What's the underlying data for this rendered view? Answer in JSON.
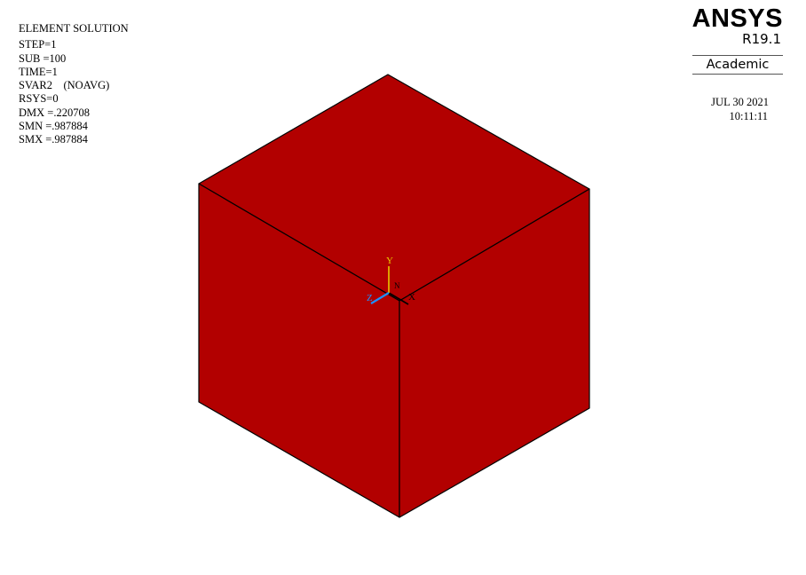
{
  "legend": {
    "title": "ELEMENT SOLUTION",
    "lines": [
      "STEP=1",
      "SUB =100",
      "TIME=1",
      "SVAR2    (NOAVG)",
      "RSYS=0",
      "DMX =.220708",
      "SMN =.987884",
      "SMX =.987884"
    ]
  },
  "brand": {
    "logo": "ANSYS",
    "version": "R19.1",
    "edition": "Academic"
  },
  "datetime": {
    "date": "JUL 30 2021",
    "time": "10:11:11"
  },
  "model": {
    "fill_color": "#b20000",
    "edge_color": "#000000"
  },
  "triad": {
    "x_label": "X",
    "y_label": "Y",
    "z_label": "Z",
    "origin_label": "N",
    "x_color": "#000000",
    "y_color": "#e8c800",
    "z_color": "#1e90ff"
  }
}
